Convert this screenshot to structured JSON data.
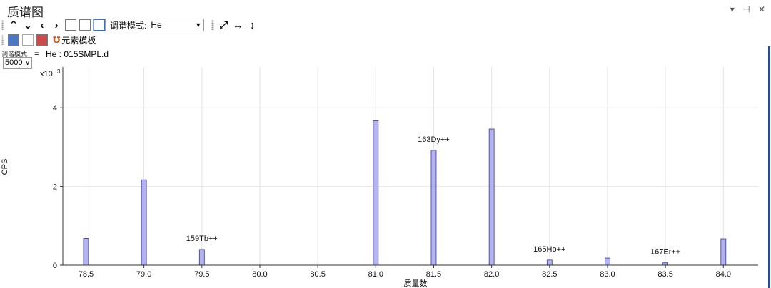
{
  "window": {
    "title": "质谱图",
    "pin_label": "▾",
    "pin_icon": "⊣",
    "close_label": "✕"
  },
  "toolbar": {
    "tune_mode_label": "调谐模式:",
    "tune_mode_value": "He",
    "element_template_label": "元素模板"
  },
  "sample": {
    "tune_small_label": "调谐模式",
    "equals": "=",
    "name": "He : 015SMPL.d",
    "count_value": "5000"
  },
  "chart_data": {
    "type": "bar",
    "xlabel": "质量数",
    "ylabel": "CPS",
    "y_multiplier_label": "x10",
    "y_multiplier_exp": "3",
    "xlim": [
      78.3,
      84.3
    ],
    "ylim": [
      0,
      5
    ],
    "x_ticks": [
      78.5,
      79.0,
      79.5,
      80.0,
      80.5,
      81.0,
      81.5,
      82.0,
      82.5,
      83.0,
      83.5,
      84.0
    ],
    "x_tick_labels": [
      "78.5",
      "79.0",
      "79.5",
      "80.0",
      "80.5",
      "81.0",
      "81.5",
      "82.0",
      "82.5",
      "83.0",
      "83.5",
      "84.0"
    ],
    "y_ticks": [
      0,
      2,
      4
    ],
    "y_tick_labels": [
      "0",
      "2",
      "4"
    ],
    "grid": true,
    "bar_color": "#b3b3f2",
    "bar_edge": "#3a3a8a",
    "bars": [
      {
        "x": 78.5,
        "y": 0.68
      },
      {
        "x": 79.0,
        "y": 2.17
      },
      {
        "x": 79.5,
        "y": 0.4
      },
      {
        "x": 81.0,
        "y": 3.67
      },
      {
        "x": 81.5,
        "y": 2.92
      },
      {
        "x": 82.0,
        "y": 3.46
      },
      {
        "x": 82.5,
        "y": 0.13
      },
      {
        "x": 83.0,
        "y": 0.18
      },
      {
        "x": 83.5,
        "y": 0.06
      },
      {
        "x": 84.0,
        "y": 0.67
      }
    ],
    "annotations": [
      {
        "x": 79.5,
        "y": 0.4,
        "label": "159Tb++"
      },
      {
        "x": 81.5,
        "y": 2.92,
        "label": "163Dy++"
      },
      {
        "x": 82.5,
        "y": 0.13,
        "label": "165Ho++"
      },
      {
        "x": 83.5,
        "y": 0.06,
        "label": "167Er++"
      }
    ]
  }
}
